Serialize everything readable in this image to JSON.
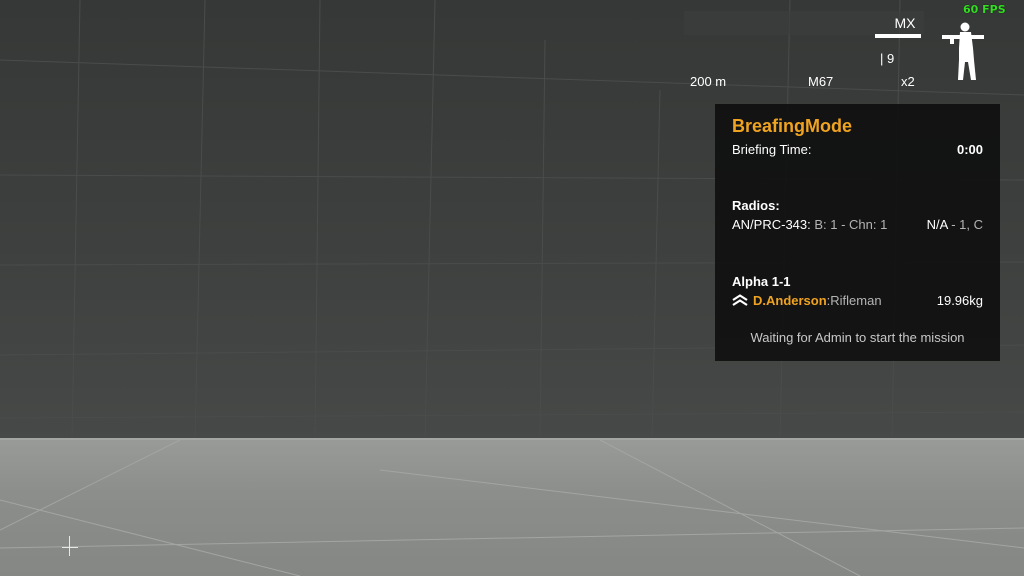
{
  "hud": {
    "fps": "60 FPS",
    "weapon": "MX",
    "ammo": "| 9",
    "zeroing": "200 m",
    "grenade": "M67",
    "zoom": "x2",
    "stance_icon": "standing-soldier-icon"
  },
  "panel": {
    "title": "BreafingMode",
    "briefing_label": "Briefing Time:",
    "briefing_value": "0:00",
    "radios_heading": "Radios:",
    "radio_name": "AN/PRC-343:",
    "radio_detail": " B: 1 - Chn: 1",
    "radio_status": "N/A",
    "radio_status_detail": " - 1, C",
    "squad": "Alpha 1-1",
    "player_name": "D.Anderson",
    "player_role": ":Rifleman",
    "player_weight": "19.96kg",
    "rank_icon": "rank-chevron-icon",
    "waiting": "Waiting for Admin to start the mission"
  },
  "colors": {
    "accent": "#f0a321",
    "fps": "#33dd22",
    "panel_bg": "#0e0e0e"
  }
}
